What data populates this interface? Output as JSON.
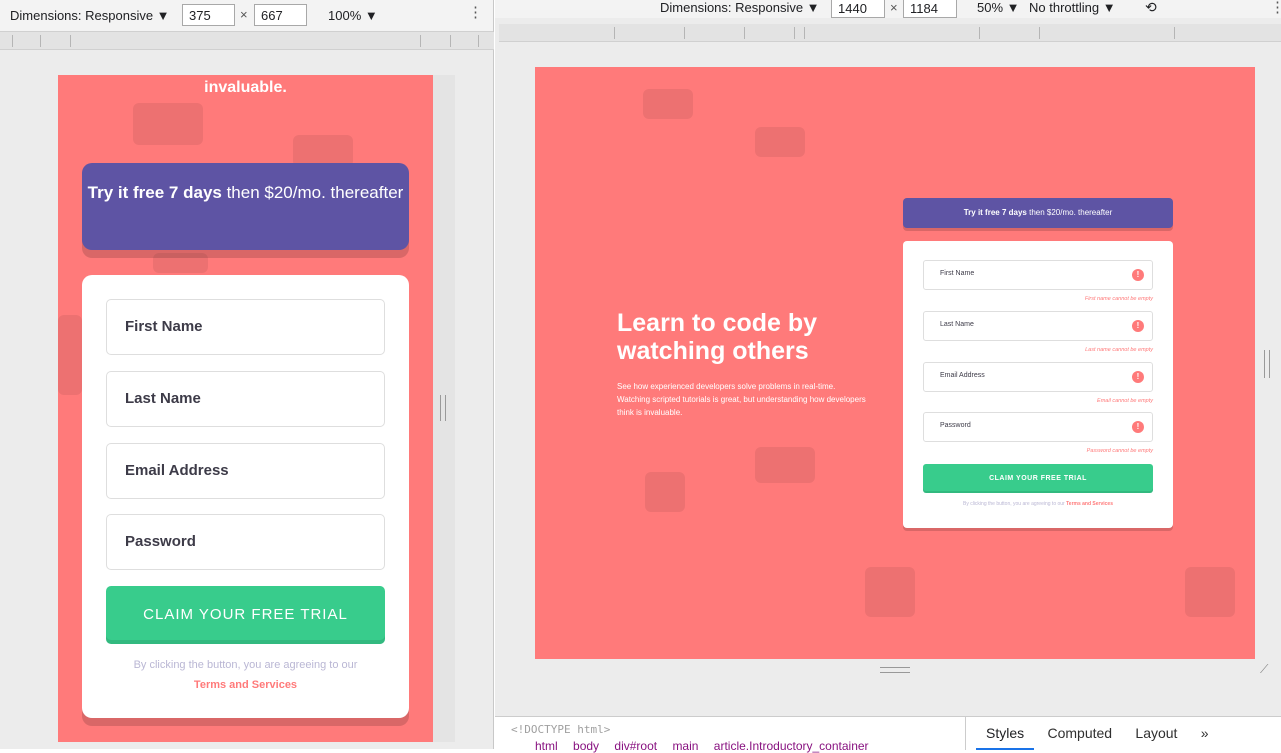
{
  "left_toolbar": {
    "dimensions_label": "Dimensions: Responsive ▼",
    "width": "375",
    "height": "667",
    "times": "×",
    "zoom": "100% ▼",
    "menu_glyph": "⋮"
  },
  "right_toolbar": {
    "dimensions_label": "Dimensions: Responsive ▼",
    "width": "1440",
    "height": "1184",
    "times": "×",
    "zoom": "50% ▼",
    "throttling": "No throttling ▼",
    "rotate_glyph": "⟲",
    "menu_glyph": "⋮"
  },
  "mobile": {
    "intro_end": "invaluable.",
    "promo_bold": "Try it free 7 days",
    "promo_rest": " then $20/mo. thereafter",
    "fields": [
      "First Name",
      "Last Name",
      "Email Address",
      "Password"
    ],
    "cta": "CLAIM YOUR FREE TRIAL",
    "terms_prefix": "By clicking the button, you are agreeing to our ",
    "terms_link": "Terms and Services"
  },
  "desktop": {
    "heading": "Learn to code by watching others",
    "subtext": "See how experienced developers solve problems in real-time. Watching scripted tutorials is great, but understanding how developers think is invaluable.",
    "promo_bold": "Try it free 7 days",
    "promo_rest": " then $20/mo. thereafter",
    "fields": [
      {
        "placeholder": "First Name",
        "error": "First name cannot be empty"
      },
      {
        "placeholder": "Last Name",
        "error": "Last name cannot be empty"
      },
      {
        "placeholder": "Email Address",
        "error": "Email cannot be empty"
      },
      {
        "placeholder": "Password",
        "error": "Password cannot be empty"
      }
    ],
    "error_glyph": "!",
    "cta": "CLAIM YOUR FREE TRIAL",
    "terms_prefix": "By clicking the button, you are agreeing to our ",
    "terms_link": "Terms and Services"
  },
  "devtools": {
    "doctype": "<!DOCTYPE html>",
    "breadcrumbs": [
      "html",
      "body",
      "div#root",
      "main",
      "article.Introductory_container"
    ],
    "tabs": [
      "Styles",
      "Computed",
      "Layout",
      "»"
    ]
  },
  "colors": {
    "background": "#ff7a7a",
    "promo": "#5e54a4",
    "cta": "#38cc8c",
    "error": "#ff7a7a"
  }
}
